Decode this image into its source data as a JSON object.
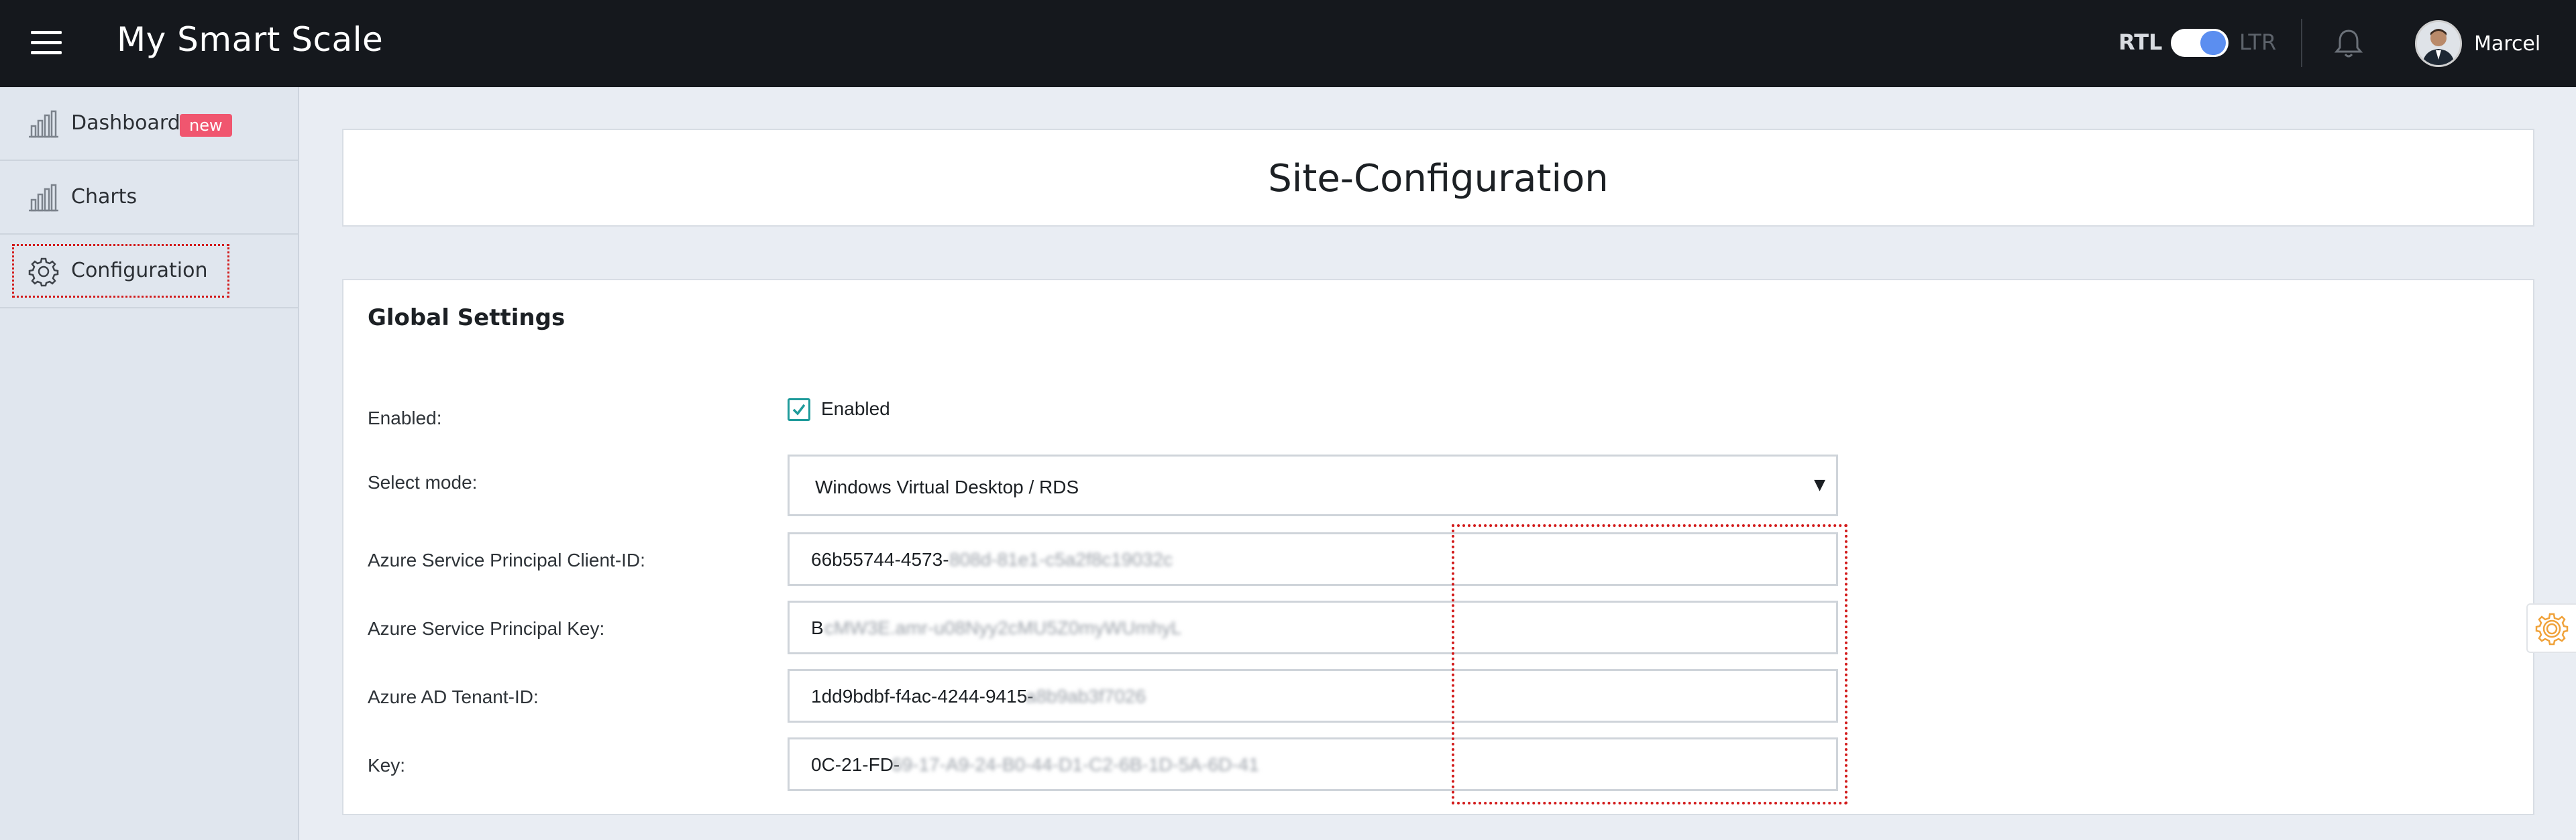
{
  "header": {
    "title": "My Smart Scale",
    "rtl_label": "RTL",
    "ltr_label": "LTR",
    "toggle_state": "on",
    "user_name": "Marcel"
  },
  "sidebar": {
    "items": [
      {
        "label": "Dashboard",
        "icon": "bar-chart-icon",
        "badge": "new",
        "active": false
      },
      {
        "label": "Charts",
        "icon": "bar-chart-icon",
        "active": false
      },
      {
        "label": "Configuration",
        "icon": "gear-icon",
        "active": true
      }
    ]
  },
  "main": {
    "page_title": "Site-Configuration",
    "section_title": "Global Settings",
    "fields": {
      "enabled": {
        "label": "Enabled:",
        "checkbox_label": "Enabled",
        "checked": true
      },
      "mode": {
        "label": "Select mode:",
        "value": "Windows Virtual Desktop / RDS"
      },
      "client_id": {
        "label": "Azure Service Principal Client-ID:",
        "value_visible": "66b55744-4573-",
        "value_blurred": "808d-81e1-c5a2f8c19032c"
      },
      "sp_key": {
        "label": "Azure Service Principal Key:",
        "value_visible": "B",
        "value_blurred": "cMW3E.amr-u08Nyy2cMU5Z0myWUmhyL"
      },
      "tenant_id": {
        "label": "Azure AD Tenant-ID:",
        "value_visible": "1dd9bdbf-f4ac-4244-9415-",
        "value_blurred": "a8b9ab3f7026"
      },
      "key": {
        "label": "Key:",
        "value_visible": "0C-21-FD-",
        "value_blurred": "69-17-A9-24-B0-44-D1-C2-6B-1D-5A-6D-41"
      }
    }
  },
  "colors": {
    "header_bg": "#15181d",
    "sidebar_bg": "#e0e6ee",
    "badge": "#f0566f",
    "toggle_knob": "#5b8ef0",
    "checkbox_accent": "#1f9b9b",
    "highlight": "#d21a1a",
    "side_gear": "#f0a23a"
  }
}
